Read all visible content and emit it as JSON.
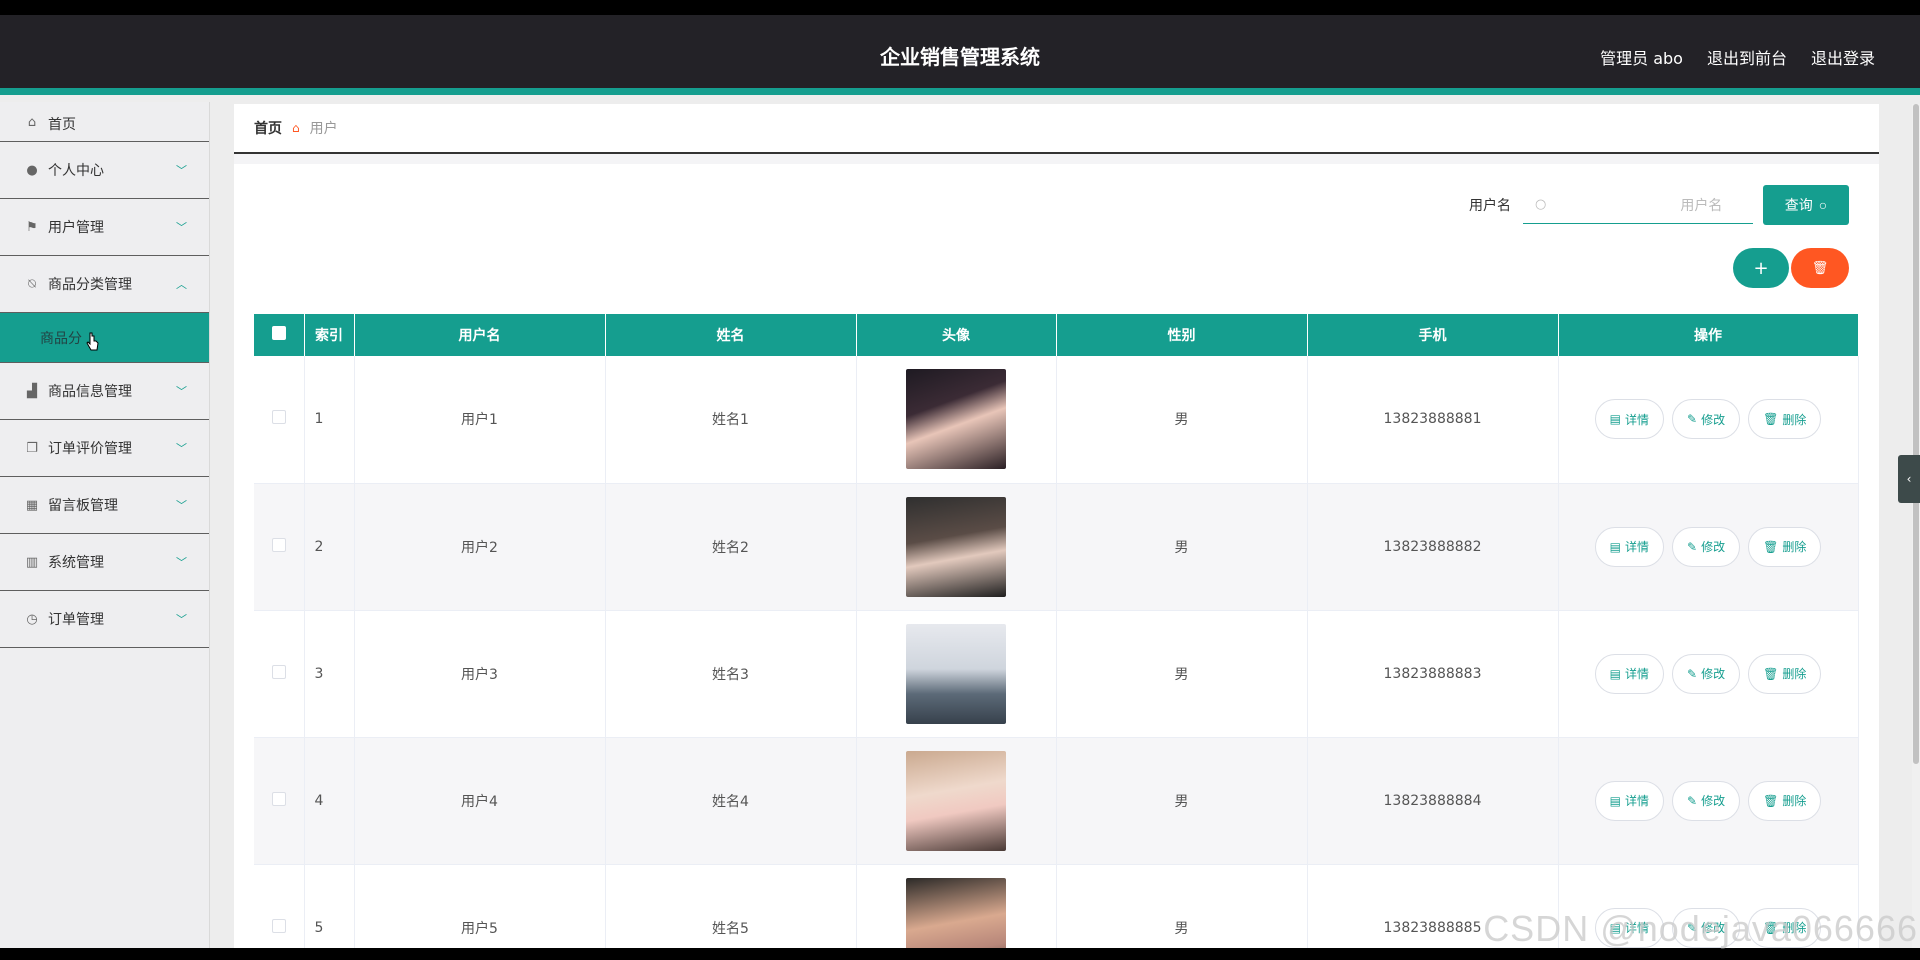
{
  "header": {
    "title": "企业销售管理系统",
    "admin": "管理员 abo",
    "exit_front": "退出到前台",
    "logout": "退出登录"
  },
  "sidebar": {
    "items": [
      {
        "label": "首页",
        "icon": "home-icon"
      },
      {
        "label": "个人中心",
        "icon": "user-icon"
      },
      {
        "label": "用户管理",
        "icon": "flag-icon"
      },
      {
        "label": "商品分类管理",
        "icon": "bell-off-icon"
      },
      {
        "label": "商品信息管理",
        "icon": "chart-icon"
      },
      {
        "label": "订单评价管理",
        "icon": "copy-icon"
      },
      {
        "label": "留言板管理",
        "icon": "grid-icon"
      },
      {
        "label": "系统管理",
        "icon": "bar-icon"
      },
      {
        "label": "订单管理",
        "icon": "compass-icon"
      }
    ],
    "submenu": {
      "label": "商品分"
    }
  },
  "breadcrumb": {
    "home": "首页",
    "current": "用户"
  },
  "search": {
    "label": "用户名",
    "placeholder": "用户名",
    "query_label": "查询"
  },
  "table": {
    "headers": [
      "索引",
      "用户名",
      "姓名",
      "头像",
      "性别",
      "手机",
      "操作"
    ],
    "actions": {
      "detail": "详情",
      "edit": "修改",
      "delete": "删除"
    },
    "rows": [
      {
        "index": "1",
        "username": "用户1",
        "name": "姓名1",
        "gender": "男",
        "phone": "13823888881"
      },
      {
        "index": "2",
        "username": "用户2",
        "name": "姓名2",
        "gender": "男",
        "phone": "13823888882"
      },
      {
        "index": "3",
        "username": "用户3",
        "name": "姓名3",
        "gender": "男",
        "phone": "13823888883"
      },
      {
        "index": "4",
        "username": "用户4",
        "name": "姓名4",
        "gender": "男",
        "phone": "13823888884"
      },
      {
        "index": "5",
        "username": "用户5",
        "name": "姓名5",
        "gender": "男",
        "phone": "13823888885"
      }
    ]
  },
  "watermark": "CSDN @nodejava066666",
  "colors": {
    "accent": "#159e8f",
    "danger": "#ff5722",
    "header_bg": "#232227"
  }
}
